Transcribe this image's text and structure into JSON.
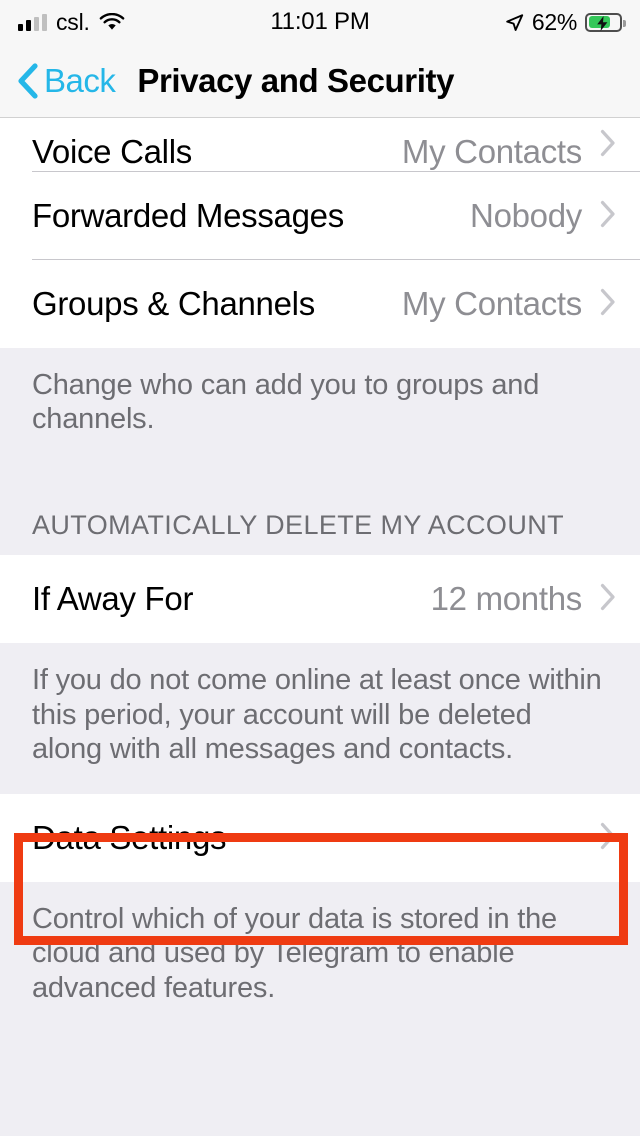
{
  "status_bar": {
    "carrier": "csl.",
    "signal_bars_filled": 2,
    "signal_bars_total": 4,
    "wifi_icon": "wifi-icon",
    "time": "11:01 PM",
    "location_icon": "location-arrow-icon",
    "battery_percent": "62%",
    "battery_level": 62,
    "battery_charging": true,
    "battery_color": "#34C759"
  },
  "nav_bar": {
    "back_icon": "chevron-left-icon",
    "back_label": "Back",
    "title": "Privacy and Security",
    "tint_color": "#25B7E8"
  },
  "list": {
    "privacy_rows": [
      {
        "label": "Voice Calls",
        "value": "My Contacts",
        "chevron": "chevron-right-icon"
      },
      {
        "label": "Forwarded Messages",
        "value": "Nobody",
        "chevron": "chevron-right-icon"
      },
      {
        "label": "Groups & Channels",
        "value": "My Contacts",
        "chevron": "chevron-right-icon"
      }
    ],
    "privacy_footer": "Change who can add you to groups and channels.",
    "delete_section_header": "AUTOMATICALLY DELETE MY ACCOUNT",
    "delete_row": {
      "label": "If Away For",
      "value": "12 months",
      "chevron": "chevron-right-icon"
    },
    "delete_footer": "If you do not come online at least once within this period, your account will be deleted along with all messages and contacts.",
    "data_row": {
      "label": "Data Settings",
      "value": "",
      "chevron": "chevron-right-icon"
    },
    "data_footer": "Control which of your data is stored in the cloud and used by Telegram to enable advanced features."
  },
  "annotation": {
    "name": "data-settings-highlight",
    "color": "#EF3B12"
  }
}
